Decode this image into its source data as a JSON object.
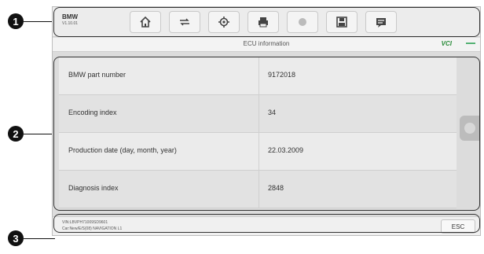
{
  "callouts": [
    "1",
    "2",
    "3"
  ],
  "toolbar": {
    "vehicle_make": "BMW",
    "vehicle_version": "V1.10.01",
    "icons": [
      "home-icon",
      "vehicle-swap-icon",
      "settings-icon",
      "print-icon",
      "help-icon",
      "save-icon",
      "data-logging-icon"
    ]
  },
  "titlebar": {
    "title": "ECU information",
    "logo": "VCI"
  },
  "ecu_info": {
    "rows": [
      {
        "name": "BMW part number",
        "value": "9172018"
      },
      {
        "name": "Encoding index",
        "value": "34"
      },
      {
        "name": "Production date (day, month, year)",
        "value": "22.03.2009"
      },
      {
        "name": "Diagnosis index",
        "value": "2848"
      }
    ]
  },
  "statusbar": {
    "line1": "VIN:LBVPH71009SD9601",
    "line2": "Car:New/E/S(08) NAVIGATION L1",
    "esc_label": "ESC"
  }
}
